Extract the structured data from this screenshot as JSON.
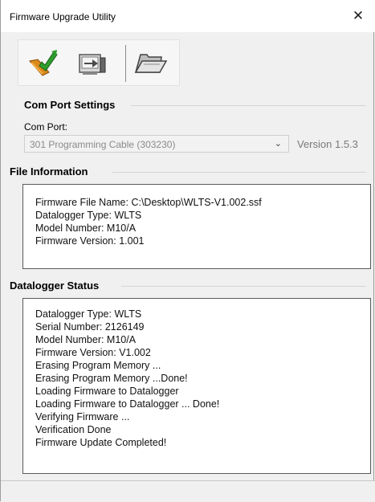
{
  "window": {
    "title": "Firmware Upgrade Utility",
    "close_symbol": "✕"
  },
  "toolbar": {
    "buttons": [
      {
        "name": "upgrade-icon"
      },
      {
        "name": "transfer-icon"
      },
      {
        "name": "open-folder-icon"
      }
    ]
  },
  "com_port": {
    "group_title": "Com Port Settings",
    "label": "Com Port:",
    "selected": "301 Programming Cable (303230)",
    "version": "Version 1.5.3"
  },
  "file_info": {
    "group_title": "File Information",
    "lines": [
      "Firmware File Name: C:\\Desktop\\WLTS-V1.002.ssf",
      "Datalogger Type: WLTS",
      "Model Number: M10/A",
      "Firmware Version: 1.001"
    ]
  },
  "status": {
    "group_title": "Datalogger Status",
    "lines": [
      "Datalogger Type: WLTS",
      "Serial Number: 2126149",
      "Model Number: M10/A",
      "Firmware Version: V1.002",
      "Erasing Program Memory ...",
      "Erasing Program Memory ...Done!",
      "Loading Firmware to Datalogger",
      "Loading Firmware to Datalogger ... Done!",
      "Verifying Firmware ...",
      "Verification Done",
      "Firmware Update Completed!"
    ]
  }
}
